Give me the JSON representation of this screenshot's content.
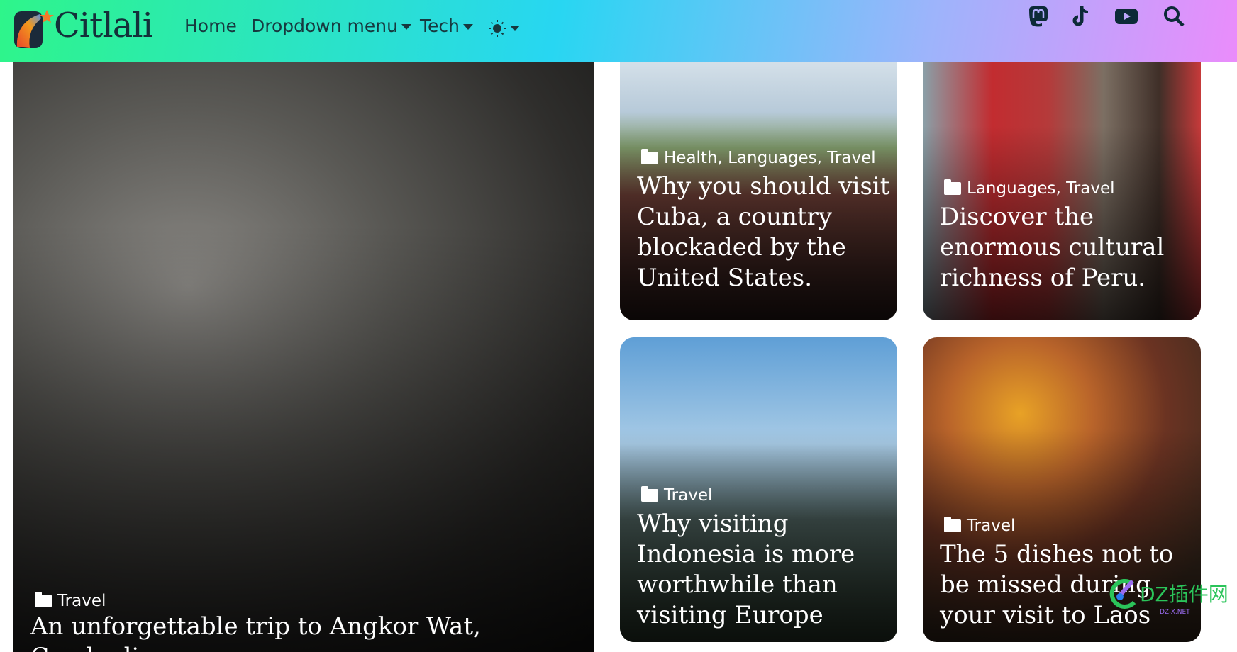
{
  "nav": {
    "brand": "Citlali",
    "links": [
      {
        "label": "Home"
      },
      {
        "label": "Dropdown menu"
      },
      {
        "label": "Tech"
      }
    ],
    "theme_icon": "sun-icon",
    "social": [
      "mastodon-icon",
      "tiktok-icon",
      "youtube-icon",
      "search-icon"
    ]
  },
  "featured": {
    "category": "Travel",
    "title": "An unforgettable trip to Angkor Wat, Cambodia"
  },
  "cards": [
    {
      "category": "Health, Languages, Travel",
      "title": "Why you should visit Cuba, a country blockaded by the United States."
    },
    {
      "category": "Languages, Travel",
      "title": "Discover the enormous cultural richness of Peru."
    },
    {
      "category": "Travel",
      "title": "Why visiting Indonesia is more worthwhile than visiting Europe"
    },
    {
      "category": "Travel",
      "title": "The 5 dishes not to be missed during your visit to Laos"
    }
  ],
  "watermark": {
    "text": "DZ插件网",
    "sub": "DZ-X.NET"
  }
}
